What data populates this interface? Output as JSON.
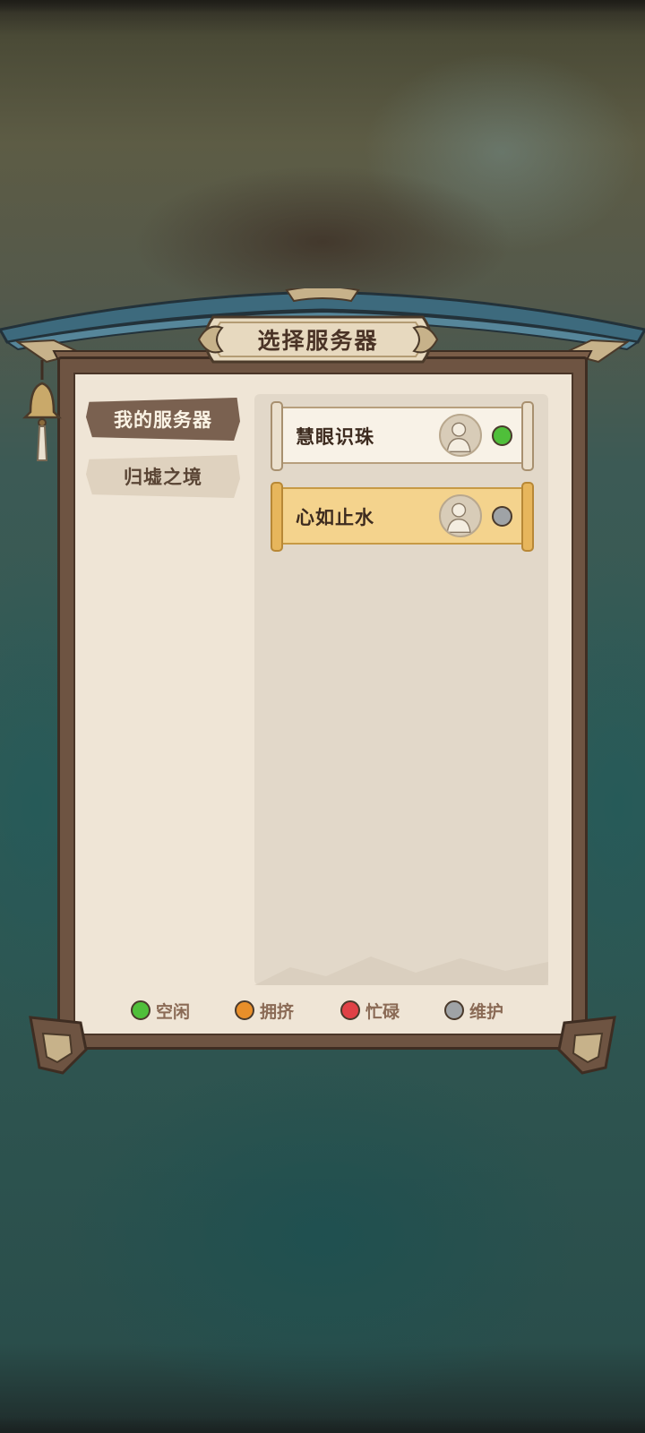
{
  "dialog": {
    "title": "选择服务器"
  },
  "tabs": [
    {
      "label": "我的服务器",
      "active": true
    },
    {
      "label": "归墟之境",
      "active": false
    }
  ],
  "servers": [
    {
      "name": "慧眼识珠",
      "status": "idle",
      "status_color": "#4fbf3a",
      "selected": false
    },
    {
      "name": "心如止水",
      "status": "maintenance",
      "status_color": "#9fa3a6",
      "selected": true
    }
  ],
  "legend": [
    {
      "label": "空闲",
      "color": "#4fbf3a"
    },
    {
      "label": "拥挤",
      "color": "#e98f2a"
    },
    {
      "label": "忙碌",
      "color": "#e04146"
    },
    {
      "label": "维护",
      "color": "#9fa3a6"
    }
  ],
  "icons": {
    "bell": "bell-icon",
    "avatar": "character-avatar-icon"
  }
}
